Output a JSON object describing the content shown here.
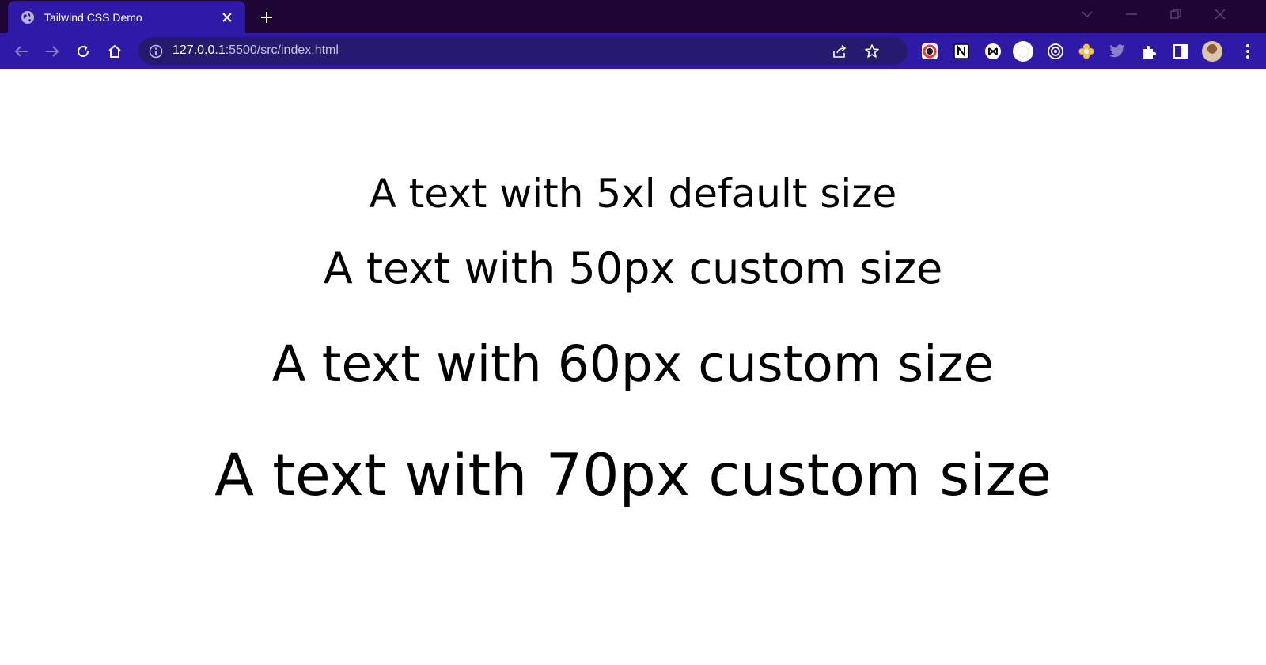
{
  "browser": {
    "tab": {
      "title": "Tailwind CSS Demo"
    },
    "address_bar": {
      "host": "127.0.0.1",
      "rest": ":5500/src/index.html"
    },
    "colors": {
      "titlebar": "#1f0533",
      "toolbar": "#2f1aa8",
      "omnibox": "#251a6e"
    },
    "extensions": [
      "colorzilla-icon",
      "notion-icon",
      "extension-icon",
      "white-circle-extension-icon",
      "target-icon",
      "flower-icon",
      "twitter-icon",
      "extensions-puzzle-icon",
      "side-panel-icon",
      "profile-avatar",
      "menu-icon"
    ]
  },
  "page": {
    "lines": [
      "A text with 5xl default size",
      "A text with 50px custom size",
      "A text with 60px custom size",
      "A text with 70px custom size"
    ]
  }
}
